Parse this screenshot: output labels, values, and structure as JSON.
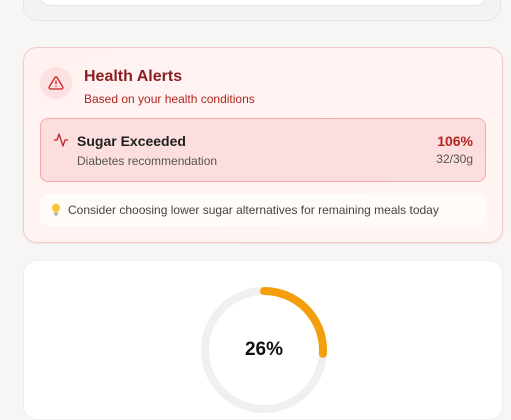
{
  "alerts": {
    "title": "Health Alerts",
    "subtitle": "Based on your health conditions",
    "icon": "warning-triangle-icon",
    "item": {
      "name": "Sugar Exceeded",
      "recommendation": "Diabetes recommendation",
      "percent": "106%",
      "amount": "32/30g",
      "icon": "pulse-icon"
    },
    "tip": {
      "icon": "lightbulb-icon",
      "text": "Consider choosing lower sugar alternatives for remaining meals today"
    }
  },
  "progress": {
    "label": "26%",
    "value": 0.26,
    "color": "#f59e0b",
    "track_color": "#f0f0f0"
  },
  "colors": {
    "alert_dark": "#8a1f1f",
    "alert_red": "#b3261e",
    "alert_bg": "#fddede"
  }
}
